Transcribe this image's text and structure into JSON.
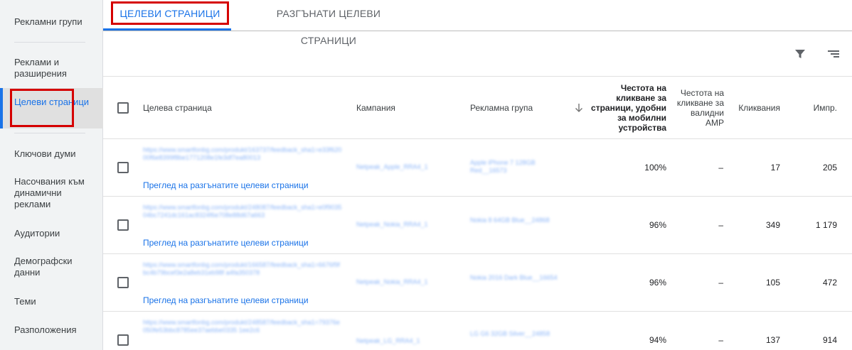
{
  "sidebar": {
    "items": [
      {
        "label": "Рекламни групи"
      },
      {
        "label": "Реклами и разширения"
      },
      {
        "label": "Целеви страници"
      },
      {
        "label": "Ключови думи"
      },
      {
        "label": "Насочвания към динамични реклами"
      },
      {
        "label": "Аудитории"
      },
      {
        "label": "Демографски данни"
      },
      {
        "label": "Теми"
      },
      {
        "label": "Разположения"
      }
    ],
    "active_color": "#1a73e8"
  },
  "tabs": [
    {
      "label": "ЦЕЛЕВИ СТРАНИЦИ"
    },
    {
      "label": "РАЗГЪНАТИ ЦЕЛЕВИ СТРАНИЦИ"
    }
  ],
  "toolbar": {
    "filter_icon": "filter-icon",
    "columns_icon": "sort-lines-icon"
  },
  "table": {
    "headers": {
      "landing_page": "Целева страница",
      "campaign": "Кампания",
      "ad_group": "Рекламна група",
      "mobile_rate": "Честота на кликване за страници, удобни за мобилни устройства",
      "amp_rate": "Честота на кликване за валидни AMP",
      "clicks": "Кликвания",
      "impressions": "Импр."
    },
    "preview_label": "Преглед на разгънатите целеви страници",
    "rows": [
      {
        "url": "https://www.smartfonbg.com/produkt/163737/feedback_sha1=e33f62000f6e8399f8be1771208e1fe3df7ea80013",
        "campaign": "Netpeak_Apple_RRA4_1",
        "ad_group": "Apple iPhone 7 128GB Red__16573",
        "mobile_rate": "100%",
        "amp_rate": "–",
        "clicks": "17",
        "impressions": "205"
      },
      {
        "url": "https://www.smartfonbg.com/produkt/248087/feedback_sha1=e0f903504bc7241dc161ac8324f6e708e88d67a663",
        "campaign": "Netpeak_Nokia_RRA4_1",
        "ad_group": "Nokia 8 64GB Blue__24868",
        "mobile_rate": "96%",
        "amp_rate": "–",
        "clicks": "349",
        "impressions": "1 179"
      },
      {
        "url": "https://www.smartfonbg.com/produkt/166587/feedback_sha1=6676f9fbc4b79bcef3e2a8eb31eb98f a4fa350378",
        "campaign": "Netpeak_Nokia_RRA4_1",
        "ad_group": "Nokia 2016 Dark Blue__16654",
        "mobile_rate": "96%",
        "amp_rate": "–",
        "clicks": "105",
        "impressions": "472"
      },
      {
        "url": "https://www.smartfonbg.com/produkt/248587/feedback_sha1=79376e050fe53bbc8785ee37aebbe0335 1ee2c6",
        "campaign": "Netpeak_LG_RRA4_1",
        "ad_group": "LG G6 32GB Silver__24858",
        "mobile_rate": "94%",
        "amp_rate": "–",
        "clicks": "137",
        "impressions": "914"
      }
    ]
  }
}
